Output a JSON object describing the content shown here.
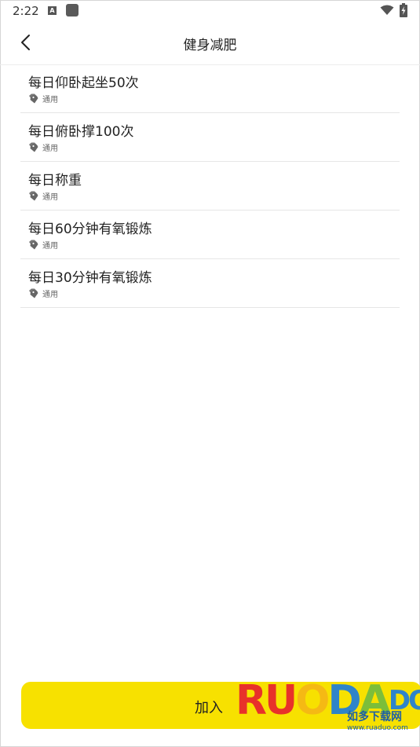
{
  "status_bar": {
    "time": "2:22",
    "a_icon_label": "A",
    "icons": [
      "a-notification-icon",
      "app-square-icon",
      "wifi-icon",
      "battery-charging-icon"
    ]
  },
  "header": {
    "title": "健身减肥",
    "back_icon": "chevron-left-icon"
  },
  "plans": [
    {
      "title": "每日仰卧起坐50次",
      "tag": "通用"
    },
    {
      "title": "每日俯卧撑100次",
      "tag": "通用"
    },
    {
      "title": "每日称重",
      "tag": "通用"
    },
    {
      "title": "每日60分钟有氧锻炼",
      "tag": "通用"
    },
    {
      "title": "每日30分钟有氧锻炼",
      "tag": "通用"
    }
  ],
  "footer": {
    "join_label": "加入"
  },
  "watermark": {
    "letters": [
      "R",
      "U",
      "O",
      "D",
      "A",
      "DO"
    ],
    "cn_text": "如多下载网",
    "url_text": "www.ruaduo.com"
  },
  "colors": {
    "accent_yellow": "#f7e100",
    "divider": "#e6e6e6",
    "text_primary": "#222222",
    "tag_text": "#666666"
  }
}
